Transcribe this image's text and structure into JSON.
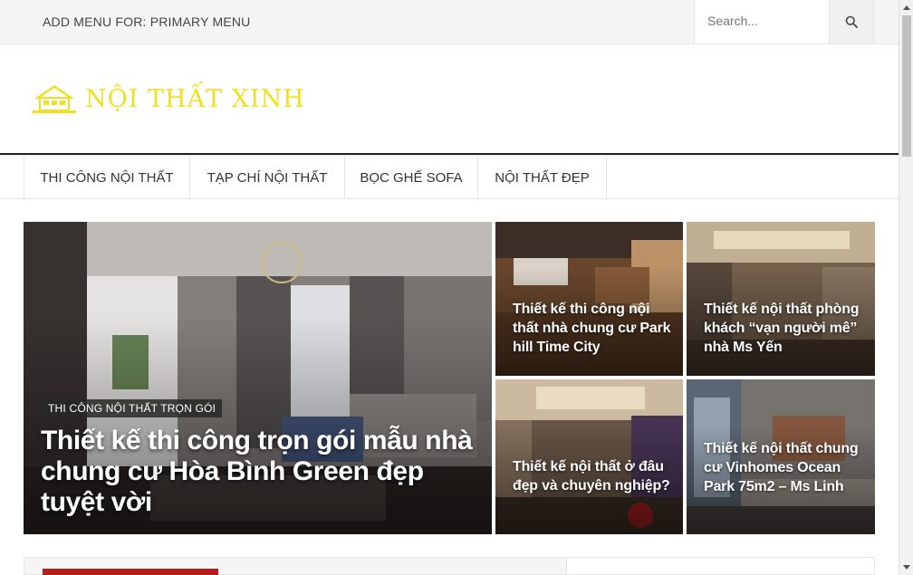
{
  "topbar": {
    "menu_note": "ADD MENU FOR: PRIMARY MENU",
    "search_placeholder": "Search..."
  },
  "header": {
    "logo_text": "NỘI THẤT XINH",
    "logo_color": "#f2e01e"
  },
  "nav": {
    "items": [
      {
        "label": "THI CÔNG NỘI THẤT"
      },
      {
        "label": "TẠP CHÍ NỘI THẤT"
      },
      {
        "label": "BỌC GHẾ SOFA"
      },
      {
        "label": "NỘI THẤT ĐẸP"
      }
    ]
  },
  "featured": {
    "main": {
      "category": "THI CÔNG NỘI THẤT TRỌN GÓI",
      "title": "Thiết kế thi công trọn gói mẫu nhà chung cư Hòa Bình Green đẹp tuyệt vời"
    },
    "posts": [
      {
        "title": "Thiết kế thi công nội thất nhà chung cư Park hill Time City"
      },
      {
        "title": "Thiết kế nội thất phòng khách “vạn người mê” nhà Ms Yến"
      },
      {
        "title": "Thiết kế nội thất ở đâu đẹp và chuyên nghiệp?"
      },
      {
        "title": "Thiết kế nội thất chung cư Vinhomes Ocean Park 75m2 – Ms Linh"
      }
    ]
  },
  "colors": {
    "accent_red": "#b71c1c"
  }
}
